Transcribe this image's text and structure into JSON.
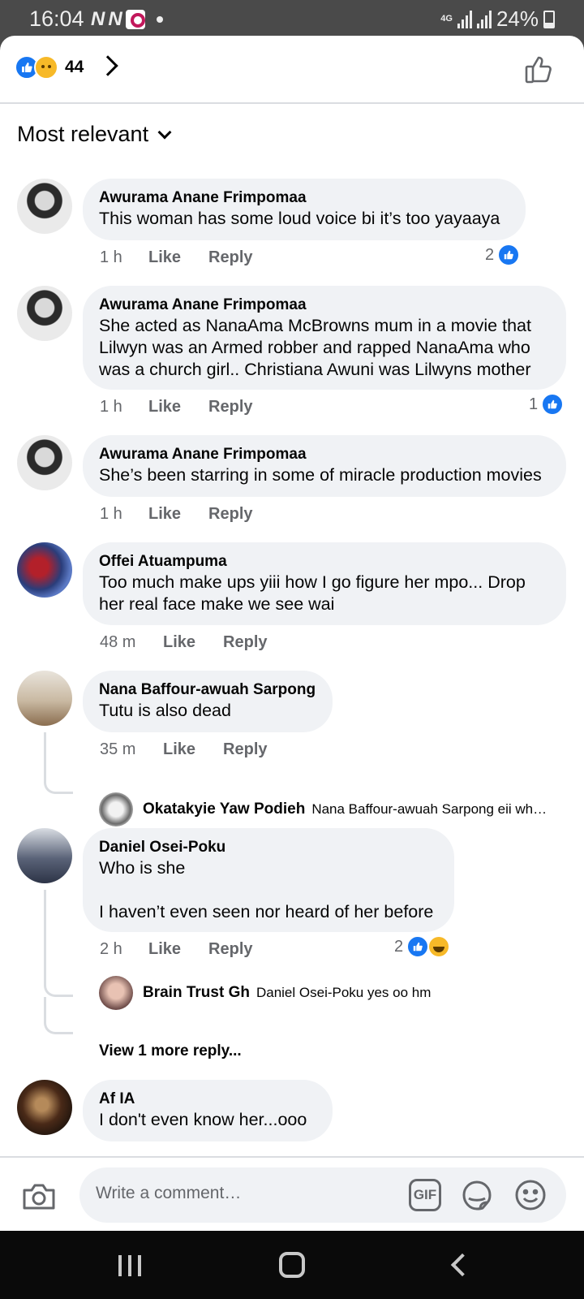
{
  "status_bar": {
    "time": "16:04",
    "notification_icons": [
      "N",
      "N"
    ],
    "network": "4G",
    "battery": "24%"
  },
  "header": {
    "reaction_icons": [
      "like-reaction-icon",
      "sad-reaction-icon"
    ],
    "reaction_count": "44"
  },
  "sort": {
    "label": "Most relevant"
  },
  "comments": [
    {
      "author": "Awurama Anane Frimpomaa",
      "text": "This woman has some loud voice bi it’s too yayaaya",
      "time": "1 h",
      "like": "Like",
      "reply": "Reply",
      "reaction_count": "2"
    },
    {
      "author": "Awurama Anane Frimpomaa",
      "text": "She acted as NanaAma McBrowns mum in a movie that Lilwyn was an Armed robber and rapped NanaAma who was a church girl.. Christiana Awuni was Lilwyns mother",
      "time": "1 h",
      "like": "Like",
      "reply": "Reply",
      "reaction_count": "1"
    },
    {
      "author": "Awurama Anane Frimpomaa",
      "text": "She’s been starring in some of miracle production movies",
      "time": "1 h",
      "like": "Like",
      "reply": "Reply"
    },
    {
      "author": "Offei Atuampuma",
      "text": "Too much make ups yiii how I go figure her mpo... Drop her real face make we see wai",
      "time": "48 m",
      "like": "Like",
      "reply": "Reply"
    },
    {
      "author": "Nana Baffour-awuah Sarpong",
      "text": "Tutu is also dead",
      "time": "35 m",
      "like": "Like",
      "reply": "Reply",
      "reply_preview": {
        "author": "Okatakyie Yaw Podieh",
        "text": "Nana Baffour-awuah Sarpong eii wh…"
      }
    },
    {
      "author": "Daniel Osei-Poku",
      "text": "Who is she\n\nI haven’t even seen nor heard of her before",
      "time": "2 h",
      "like": "Like",
      "reply": "Reply",
      "reaction_count": "2",
      "reply_preview": {
        "author": "Brain Trust Gh",
        "text": "Daniel Osei-Poku yes oo hm"
      },
      "view_more": "View 1 more reply..."
    },
    {
      "author": "Af IA",
      "text": "I don't even know her...ooo"
    }
  ],
  "composer": {
    "placeholder": "Write a comment…",
    "gif_label": "GIF"
  },
  "colors": {
    "accent": "#1877f2",
    "bubble": "#f0f2f5",
    "secondary_text": "#65676b"
  }
}
